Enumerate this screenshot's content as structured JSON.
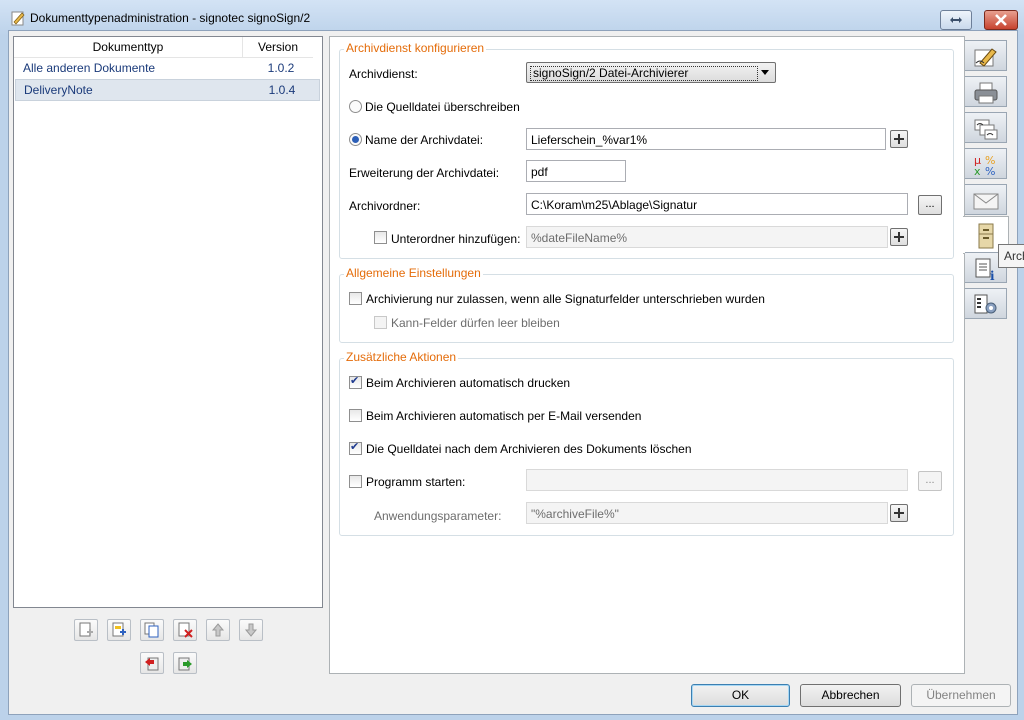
{
  "window": {
    "title": "Dokumenttypenadministration - signotec signoSign/2"
  },
  "list": {
    "headers": {
      "type": "Dokumenttyp",
      "version": "Version"
    },
    "rows": [
      {
        "name": "Alle anderen Dokumente",
        "version": "1.0.2"
      },
      {
        "name": "DeliveryNote",
        "version": "1.0.4"
      }
    ]
  },
  "archive_config": {
    "legend": "Archivdienst konfigurieren",
    "service_label": "Archivdienst:",
    "service_value": "signoSign/2 Datei-Archivierer",
    "overwrite_label": "Die Quelldatei überschreiben",
    "filename_label": "Name der Archivdatei:",
    "filename_value": "Lieferschein_%var1%",
    "extension_label": "Erweiterung der Archivdatei:",
    "extension_value": "pdf",
    "folder_label": "Archivordner:",
    "folder_value": "C:\\Koram\\m25\\Ablage\\Signatur",
    "browse_label": "...",
    "subfolder_label": "Unterordner hinzufügen:",
    "subfolder_value": "%dateFileName%"
  },
  "general": {
    "legend": "Allgemeine Einstellungen",
    "only_signed_label": "Archivierung nur zulassen, wenn alle Signaturfelder unterschrieben wurden",
    "empty_fields_label": "Kann-Felder dürfen leer bleiben"
  },
  "actions": {
    "legend": "Zusätzliche Aktionen",
    "print_label": "Beim Archivieren automatisch drucken",
    "print_checked": true,
    "email_label": "Beim Archivieren automatisch per E-Mail versenden",
    "email_checked": false,
    "delete_label": "Die Quelldatei nach dem Archivieren des Dokuments löschen",
    "delete_checked": true,
    "program_label": "Programm starten:",
    "program_value": "",
    "program_browse_label": "...",
    "params_label": "Anwendungsparameter:",
    "params_value": "\"%archiveFile%\""
  },
  "tooltip": "Archiv",
  "side_tabs": [
    "signature-pen-icon",
    "printer-icon",
    "signatures-icon",
    "fields-icon",
    "email-icon",
    "archive-cabinet-icon",
    "document-info-icon",
    "settings-doc-icon"
  ],
  "toolbar": [
    "new-document-icon",
    "edit-document-icon",
    "copy-document-icon",
    "delete-document-icon",
    "move-up-icon",
    "move-down-icon",
    "import-icon",
    "export-icon"
  ],
  "buttons": {
    "ok": "OK",
    "cancel": "Abbrechen",
    "apply": "Übernehmen"
  },
  "colors": {
    "legend": "#e46c0a",
    "title_bar": "#bcd2ea",
    "list_text": "#1a3a7a"
  }
}
